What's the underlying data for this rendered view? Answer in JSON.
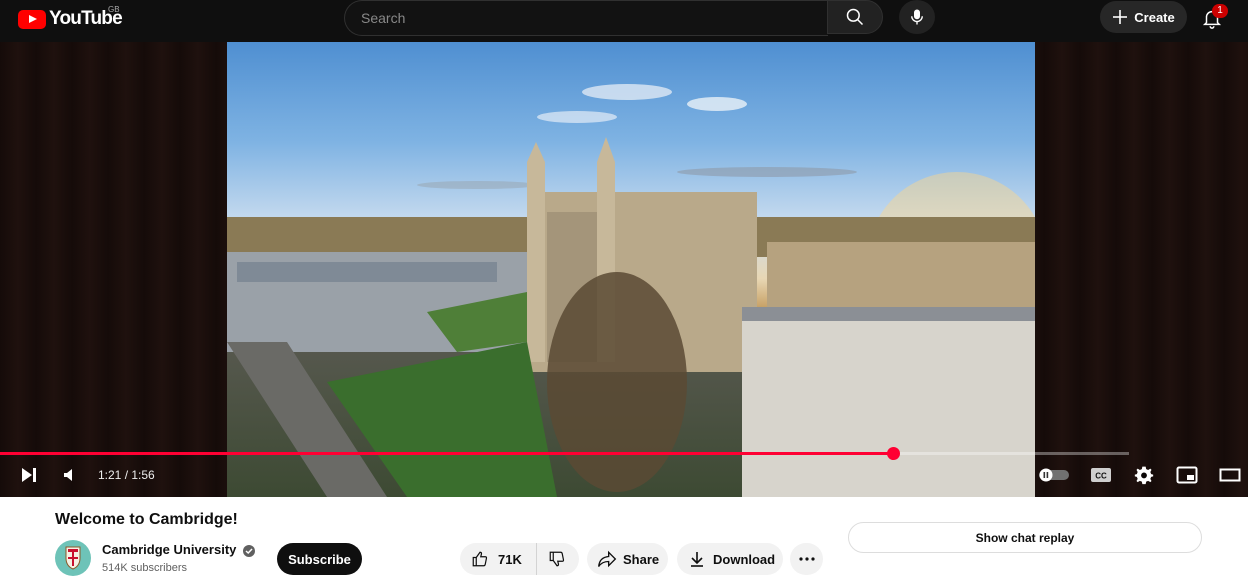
{
  "header": {
    "logo_text": "YouTube",
    "country_code": "GB",
    "search_placeholder": "Search",
    "create_label": "Create",
    "notification_count": "1"
  },
  "player": {
    "current_time": "1:21",
    "duration": "1:56",
    "time_display": "1:21 / 1:56",
    "progress_fraction": 0.7155,
    "buffered_fraction": 1.0
  },
  "video": {
    "title": "Welcome to Cambridge!"
  },
  "channel": {
    "name": "Cambridge University",
    "subscribers": "514K subscribers",
    "subscribe_label": "Subscribe"
  },
  "actions": {
    "like_count": "71K",
    "share_label": "Share",
    "download_label": "Download"
  },
  "chat": {
    "replay_label": "Show chat replay"
  },
  "colors": {
    "brand_red": "#ff0000",
    "progress_red": "#ff0033",
    "topbar_bg": "#0f0f0f"
  }
}
